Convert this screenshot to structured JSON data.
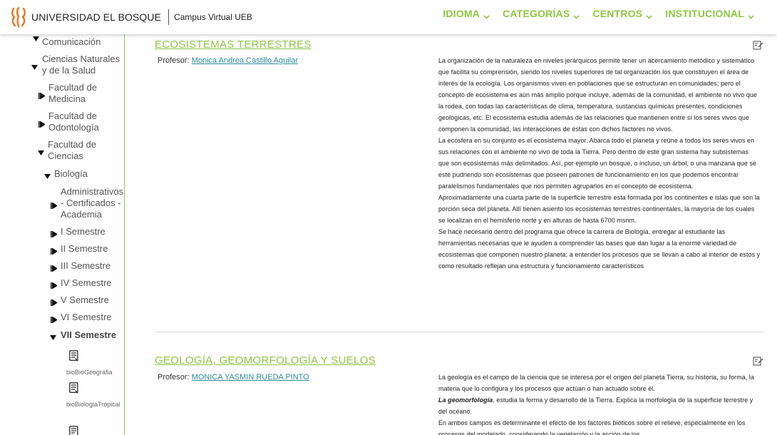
{
  "header": {
    "brand_name": "UNIVERSIDAD EL BOSQUE",
    "brand_sub": "Campus Virtual UEB",
    "logo_icon": "university-flame-logo",
    "nav": [
      {
        "label": "IDIOMA"
      },
      {
        "label": "CATEGORÍAS"
      },
      {
        "label": "CENTROS"
      },
      {
        "label": "INSTITUCIONAL"
      }
    ]
  },
  "colors": {
    "accent_green": "#8cc63f",
    "logo_orange": "#e8741e",
    "link_teal": "#2a8a9a"
  },
  "sidebar": {
    "items": [
      {
        "label": "Comunicación",
        "expander": "none"
      },
      {
        "label": "Ciencias Naturales y de la Salud",
        "expander": "expanded"
      },
      {
        "label": "Facultad de Medicina",
        "expander": "collapsed"
      },
      {
        "label": "Facultad de Odontología",
        "expander": "collapsed"
      },
      {
        "label": "Facultad de Ciencias",
        "expander": "expanded"
      },
      {
        "label": "Biología",
        "expander": "expanded"
      },
      {
        "label": "Administrativos - Certificados - Academia",
        "expander": "collapsed"
      },
      {
        "label": "I Semestre",
        "expander": "collapsed"
      },
      {
        "label": "II Semestre",
        "expander": "collapsed"
      },
      {
        "label": "III Semestre",
        "expander": "collapsed"
      },
      {
        "label": "IV Semestre",
        "expander": "collapsed"
      },
      {
        "label": "V Semestre",
        "expander": "collapsed"
      },
      {
        "label": "VI Semestre",
        "expander": "collapsed"
      },
      {
        "label": "VII Semestre",
        "expander": "expanded",
        "active": true
      }
    ],
    "courses": [
      {
        "label": "bioBioGeografia",
        "icon": "course-document-icon"
      },
      {
        "label": "bioBiologiaTropical",
        "icon": "course-document-icon"
      },
      {
        "label": "",
        "icon": "course-document-icon"
      }
    ]
  },
  "courses": [
    {
      "title": "ECOSISTEMAS TERRESTRES",
      "professor_label": "Profesor:",
      "professor_name": "Monica Andrea Castillo Aguilar",
      "description": [
        "La organización de la naturaleza en niveles jerárquicos permite tener un acercamiento metódico y sistemático que facilita su comprensión, siendo los niveles superiores de tal organización los que constituyen el área de interés de la ecología. Los organismos viven en poblaciones que se estructuran en comunidades; pero el concepto de ecosistema es aún más amplio porque incluye, además de la comunidad, el ambiente no vivo que la rodea, con todas las características de clima, temperatura, sustancias químicas presentes, condiciones geológicas, etc. El ecosistema estudia además de las relaciones que mantienen entre sí los seres vivos que componen la comunidad, las interacciones de éstas con dichos factores no vivos.",
        "La ecósfera en su conjunto es el ecosistema mayor. Abarca todo el planeta y reúne a todos los seres vivos en sus relaciones con el ambiente no vivo de toda la Tierra. Pero dentro de este gran sistema hay subsistemas que son ecosistemas más delimitados. Así, por ejemplo un bosque, o incluso, un árbol, o una manzana que se esté pudriendo son ecosistemas que poseen patrones de funcionamiento en los que podemos encontrar paralelismos fundamentales que nos permiten agruparlos en el concepto de ecosistema.",
        "Aproximadamente una cuarta parte de la superficie terrestre esta formada por los continentes e islas que son la porción seca del planeta. Allí tienen asiento los ecosistemas terrestres continentales, la mayoría de los cuales se localizan en el hemisferio norte y en alturas de hasta 6700 msnm.",
        "Se hace necesario dentro del programa que ofrece la carrera de Biología, entregar al estudiante las herramientas necesarias que le ayuden a comprender las bases que dan lugar a la enorme variedad de ecosistemas que componen nuestro planeta; a entender los procesos que se llevan a cabo al interior de estos y como resultado reflejan una estructura y funcionamiento característicos"
      ]
    },
    {
      "title": "GEOLOGÍA, GEOMORFOLOGÍA Y SUELOS",
      "professor_label": "Profesor:",
      "professor_name": "MONICA YASMIN RUEDA PINTO",
      "description_p1": "La geología es el campo de la ciencia que se interesa por el origen del planeta Tierra, su historia, su forma, la materia que lo configura y los procesos que actúan o han actuado sobre él.",
      "description_emph": "La geomorfología",
      "description_p2_rest": ", estudia la forma y desarrollo de la Tierra. Explica la morfología de la superficie terrestre y del océano.",
      "description_p3": "En ambos campos es determinante el efecto de los factores bióticos sobre el relieve, especialmente en los procesos del modelado, considerando la vegetación y la acción de los"
    }
  ]
}
